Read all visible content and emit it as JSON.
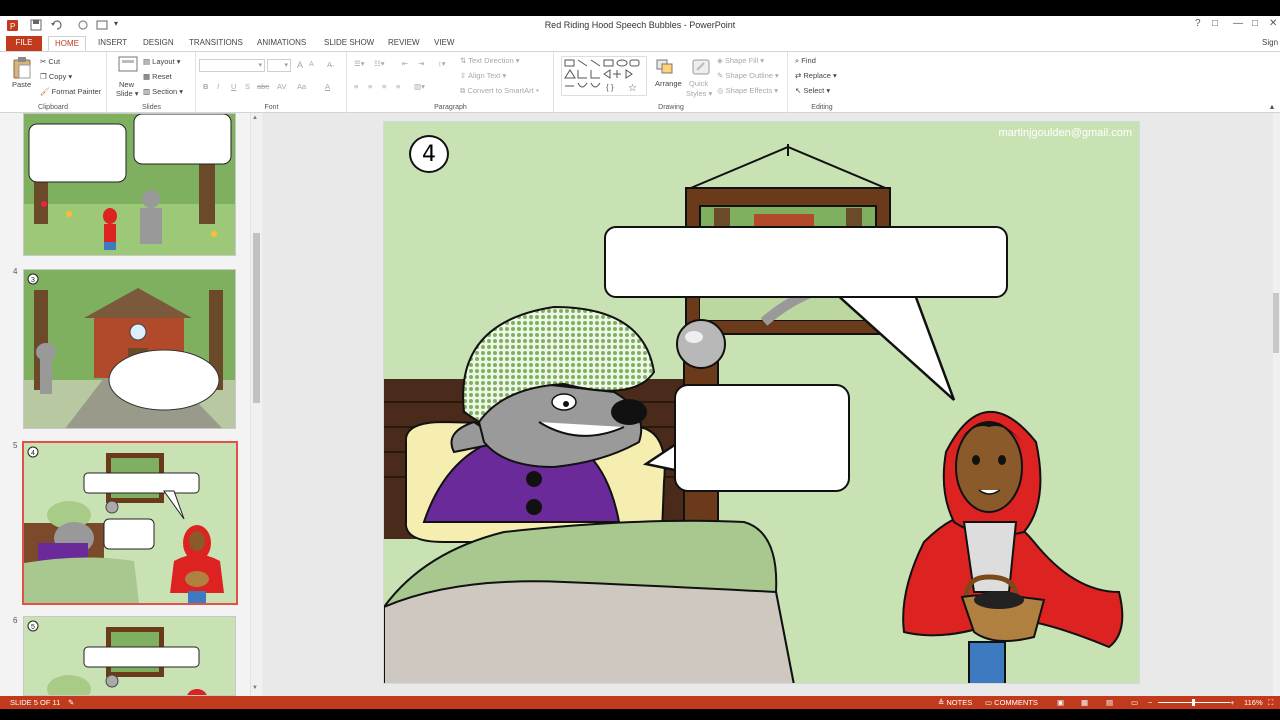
{
  "window": {
    "title": "Red Riding Hood Speech Bubbles - PowerPoint",
    "help": "?",
    "restore": "□",
    "minimize": "—",
    "maximize": "□",
    "close": "✕",
    "signin": "Sign i"
  },
  "tabs": [
    "FILE",
    "HOME",
    "INSERT",
    "DESIGN",
    "TRANSITIONS",
    "ANIMATIONS",
    "SLIDE SHOW",
    "REVIEW",
    "VIEW"
  ],
  "ribbon": {
    "clipboard": {
      "paste": "Paste",
      "cut": "Cut",
      "copy": "Copy",
      "format_painter": "Format Painter",
      "label": "Clipboard"
    },
    "slides": {
      "new_slide": "New",
      "new_slide2": "Slide",
      "layout": "Layout",
      "reset": "Reset",
      "section": "Section",
      "label": "Slides"
    },
    "font": {
      "bold": "B",
      "italic": "I",
      "underline": "U",
      "shadow": "S",
      "strike": "abc",
      "spacing": "AV",
      "case": "Aa",
      "color": "A",
      "grow": "A",
      "shrink": "A",
      "label": "Font"
    },
    "paragraph": {
      "text_direction": "Text Direction",
      "align_text": "Align Text",
      "convert_smartart": "Convert to SmartArt",
      "label": "Paragraph"
    },
    "drawing": {
      "arrange": "Arrange",
      "quick_styles": "Quick",
      "quick_styles2": "Styles",
      "shape_fill": "Shape Fill",
      "shape_outline": "Shape Outline",
      "shape_effects": "Shape Effects",
      "label": "Drawing"
    },
    "editing": {
      "find": "Find",
      "replace": "Replace",
      "select": "Select",
      "label": "Editing"
    }
  },
  "thumbnails": [
    {
      "num": "4",
      "badge": "3"
    },
    {
      "num": "5",
      "badge": "4",
      "selected": true
    },
    {
      "num": "6",
      "badge": "5"
    }
  ],
  "slide": {
    "number": "4",
    "email": "martinjgoulden@gmail.com"
  },
  "status": {
    "slide": "SLIDE 5 OF 11",
    "notes": "NOTES",
    "comments": "COMMENTS",
    "zoom": "116%"
  },
  "colors": {
    "accent": "#c13a1c",
    "slide_bg": "#c9e2b4",
    "wolf_gray": "#9a9a9a",
    "wolf_purple": "#6a2a9a",
    "hood_red": "#dd2222"
  }
}
